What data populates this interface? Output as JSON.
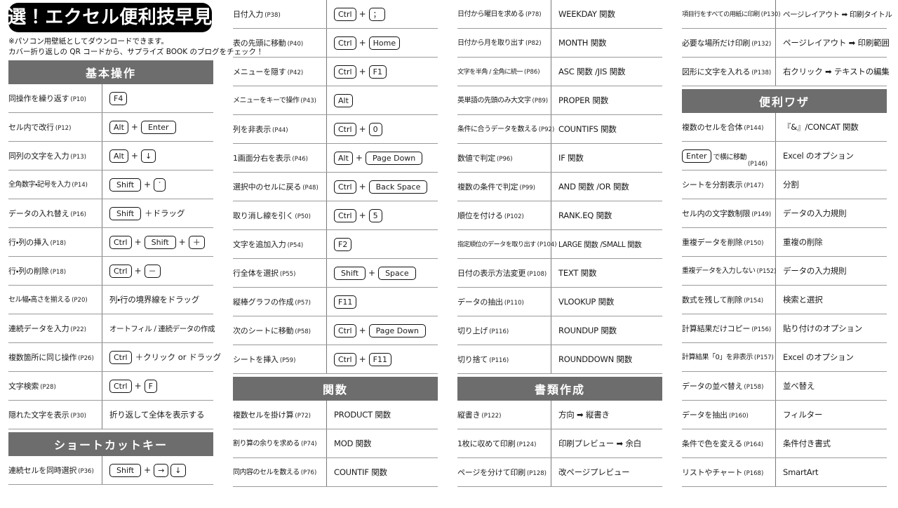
{
  "title": "厳選！エクセル便利技早見表",
  "notes": [
    "※パソコン用壁紙としてダウンロードできます。",
    "カバー折り返しの QR コードから、サプライズ BOOK のブログをチェック！"
  ],
  "colors": {
    "band_bg": "#6d6d6d",
    "band_text": "#ffffff",
    "title_bg": "#000000",
    "title_text": "#ffffff",
    "rule": "#9a9a9a"
  },
  "sections": {
    "basic": "基本操作",
    "shortcut": "ショートカットキー",
    "function": "関数",
    "document": "書類作成",
    "tips": "便利ワザ"
  },
  "columns": [
    {
      "id": "col1",
      "rows": [
        {
          "label": "同操作を繰り返す",
          "page": "(P10)",
          "keys": [
            "F4"
          ]
        },
        {
          "label": "セル内で改行",
          "page": "(P12)",
          "keys": [
            "Alt",
            "+",
            "Enter"
          ]
        },
        {
          "label": "同列の文字を入力",
          "page": "(P13)",
          "keys": [
            "Alt",
            "+",
            "↓"
          ]
        },
        {
          "label": "全角数字・記号を入力",
          "page": "(P14)",
          "keys": [
            "Shift",
            "+",
            "′"
          ]
        },
        {
          "label": "データの入れ替え",
          "page": "(P16)",
          "keys": [
            "Shift"
          ],
          "suffix": "＋ドラッグ"
        },
        {
          "label": "行・列の挿入",
          "page": "(P18)",
          "keys": [
            "Ctrl",
            "+",
            "Shift",
            "+",
            "＋"
          ]
        },
        {
          "label": "行・列の削除",
          "page": "(P18)",
          "keys": [
            "Ctrl",
            "+",
            "－"
          ]
        },
        {
          "label": "セル幅・高さを揃える",
          "page": "(P20)",
          "text": "列・行の境界線をドラッグ"
        },
        {
          "label": "連続データを入力",
          "page": "(P22)",
          "text": "オートフィル / 連続データの作成"
        },
        {
          "label": "複数箇所に同じ操作",
          "page": "(P26)",
          "keys": [
            "Ctrl"
          ],
          "suffix": "＋クリック or ドラッグ"
        },
        {
          "label": "文字検索",
          "page": "(P28)",
          "keys": [
            "Ctrl",
            "+",
            "F"
          ]
        },
        {
          "label": "隠れた文字を表示",
          "page": "(P30)",
          "text": "折り返して全体を表示する"
        }
      ],
      "rows_after_band": [
        {
          "label": "連続セルを同時選択",
          "page": "(P36)",
          "keys": [
            "Shift",
            "+",
            "→",
            "↓"
          ]
        }
      ]
    },
    {
      "id": "col2",
      "rows": [
        {
          "label": "日付入力",
          "page": "(P38)",
          "keys": [
            "Ctrl",
            "+",
            "；"
          ]
        },
        {
          "label": "表の先頭に移動",
          "page": "(P40)",
          "keys": [
            "Ctrl",
            "+",
            "Home"
          ]
        },
        {
          "label": "メニューを隠す",
          "page": "(P42)",
          "keys": [
            "Ctrl",
            "+",
            "F1"
          ]
        },
        {
          "label": "メニューをキーで操作",
          "page": "(P43)",
          "keys": [
            "Alt"
          ]
        },
        {
          "label": "列を非表示",
          "page": "(P44)",
          "keys": [
            "Ctrl",
            "+",
            "0"
          ]
        },
        {
          "label": "1画面分右を表示",
          "page": "(P46)",
          "keys": [
            "Alt",
            "+",
            "Page Down"
          ]
        },
        {
          "label": "選択中のセルに戻る",
          "page": "(P48)",
          "keys": [
            "Ctrl",
            "+",
            "Back Space"
          ]
        },
        {
          "label": "取り消し線を引く",
          "page": "(P50)",
          "keys": [
            "Ctrl",
            "+",
            "5"
          ]
        },
        {
          "label": "文字を追加入力",
          "page": "(P54)",
          "keys": [
            "F2"
          ]
        },
        {
          "label": "行全体を選択",
          "page": "(P55)",
          "keys": [
            "Shift",
            "+",
            "Space"
          ]
        },
        {
          "label": "縦棒グラフの作成",
          "page": "(P57)",
          "keys": [
            "F11"
          ]
        },
        {
          "label": "次のシートに移動",
          "page": "(P58)",
          "keys": [
            "Ctrl",
            "+",
            "Page Down"
          ]
        },
        {
          "label": "シートを挿入",
          "page": "(P59)",
          "keys": [
            "Ctrl",
            "+",
            "F11"
          ]
        }
      ],
      "rows_after_band": [
        {
          "label": "複数セルを掛け算",
          "page": "(P72)",
          "text": "PRODUCT 関数"
        },
        {
          "label": "割り算の余りを求める",
          "page": "(P74)",
          "text": "MOD 関数"
        },
        {
          "label": "同内容のセルを数える",
          "page": "(P76)",
          "text": "COUNTIF 関数"
        }
      ]
    },
    {
      "id": "col3",
      "rows": [
        {
          "label": "日付から曜日を求める",
          "page": "(P78)",
          "text": "WEEKDAY 関数"
        },
        {
          "label": "日付から月を取り出す",
          "page": "(P82)",
          "text": "MONTH 関数"
        },
        {
          "label": "文字を半角 / 全角に統一",
          "page": "(P86)",
          "text": "ASC 関数 /JIS 関数"
        },
        {
          "label": "英単語の先頭のみ大文字",
          "page": "(P89)",
          "text": "PROPER 関数"
        },
        {
          "label": "条件に合うデータを数える",
          "page": "(P92)",
          "text": "COUNTIFS 関数"
        },
        {
          "label": "数値で判定",
          "page": "(P96)",
          "text": "IF 関数"
        },
        {
          "label": "複数の条件で判定",
          "page": "(P99)",
          "text": "AND 関数 /OR 関数"
        },
        {
          "label": "順位を付ける",
          "page": "(P102)",
          "text": "RANK.EQ 関数"
        },
        {
          "label": "指定順位のデータを取り出す",
          "page": "(P104)",
          "text": "LARGE 関数 /SMALL 関数"
        },
        {
          "label": "日付の表示方法変更",
          "page": "(P108)",
          "text": "TEXT 関数"
        },
        {
          "label": "データの抽出",
          "page": "(P110)",
          "text": "VLOOKUP 関数"
        },
        {
          "label": "切り上げ",
          "page": "(P116)",
          "text": "ROUNDUP 関数"
        },
        {
          "label": "切り捨て",
          "page": "(P116)",
          "text": "ROUNDDOWN 関数"
        }
      ],
      "rows_after_band": [
        {
          "label": "縦書き",
          "page": "(P122)",
          "text": "方向 ➡ 縦書き"
        },
        {
          "label": "1枚に収めて印刷",
          "page": "(P124)",
          "text": "印刷プレビュー ➡ 余白"
        },
        {
          "label": "ページを分けて印刷",
          "page": "(P128)",
          "text": "改ページプレビュー"
        }
      ]
    },
    {
      "id": "col4",
      "rows": [
        {
          "label": "項目行をすべての用紙に印刷",
          "page": "(P130)",
          "text": "ページレイアウト ➡ 印刷タイトル"
        },
        {
          "label": "必要な場所だけ印刷",
          "page": "(P132)",
          "text": "ページレイアウト ➡ 印刷範囲"
        },
        {
          "label": "図形に文字を入れる",
          "page": "(P138)",
          "text": "右クリック ➡ テキストの編集"
        }
      ],
      "rows_after_band": [
        {
          "label": "複数のセルを合体",
          "page": "(P144)",
          "text": "『&』/CONCAT 関数"
        },
        {
          "label": "で横に移動",
          "page": "(P146)",
          "label_key": "Enter",
          "text": "Excel のオプション"
        },
        {
          "label": "シートを分割表示",
          "page": "(P147)",
          "text": "分割"
        },
        {
          "label": "セル内の文字数制限",
          "page": "(P149)",
          "text": "データの入力規則"
        },
        {
          "label": "重複データを削除",
          "page": "(P150)",
          "text": "重複の削除"
        },
        {
          "label": "重複データを入力しない",
          "page": "(P152)",
          "text": "データの入力規則"
        },
        {
          "label": "数式を残して削除",
          "page": "(P154)",
          "text": "検索と選択"
        },
        {
          "label": "計算結果だけコピー",
          "page": "(P156)",
          "text": "貼り付けのオプション"
        },
        {
          "label": "計算結果「0」を非表示",
          "page": "(P157)",
          "text": "Excel のオプション"
        },
        {
          "label": "データの並べ替え",
          "page": "(P158)",
          "text": "並べ替え"
        },
        {
          "label": "データを抽出",
          "page": "(P160)",
          "text": "フィルター"
        },
        {
          "label": "条件で色を変える",
          "page": "(P164)",
          "text": "条件付き書式"
        },
        {
          "label": "リストやチャート",
          "page": "(P168)",
          "text": "SmartArt"
        }
      ]
    }
  ]
}
